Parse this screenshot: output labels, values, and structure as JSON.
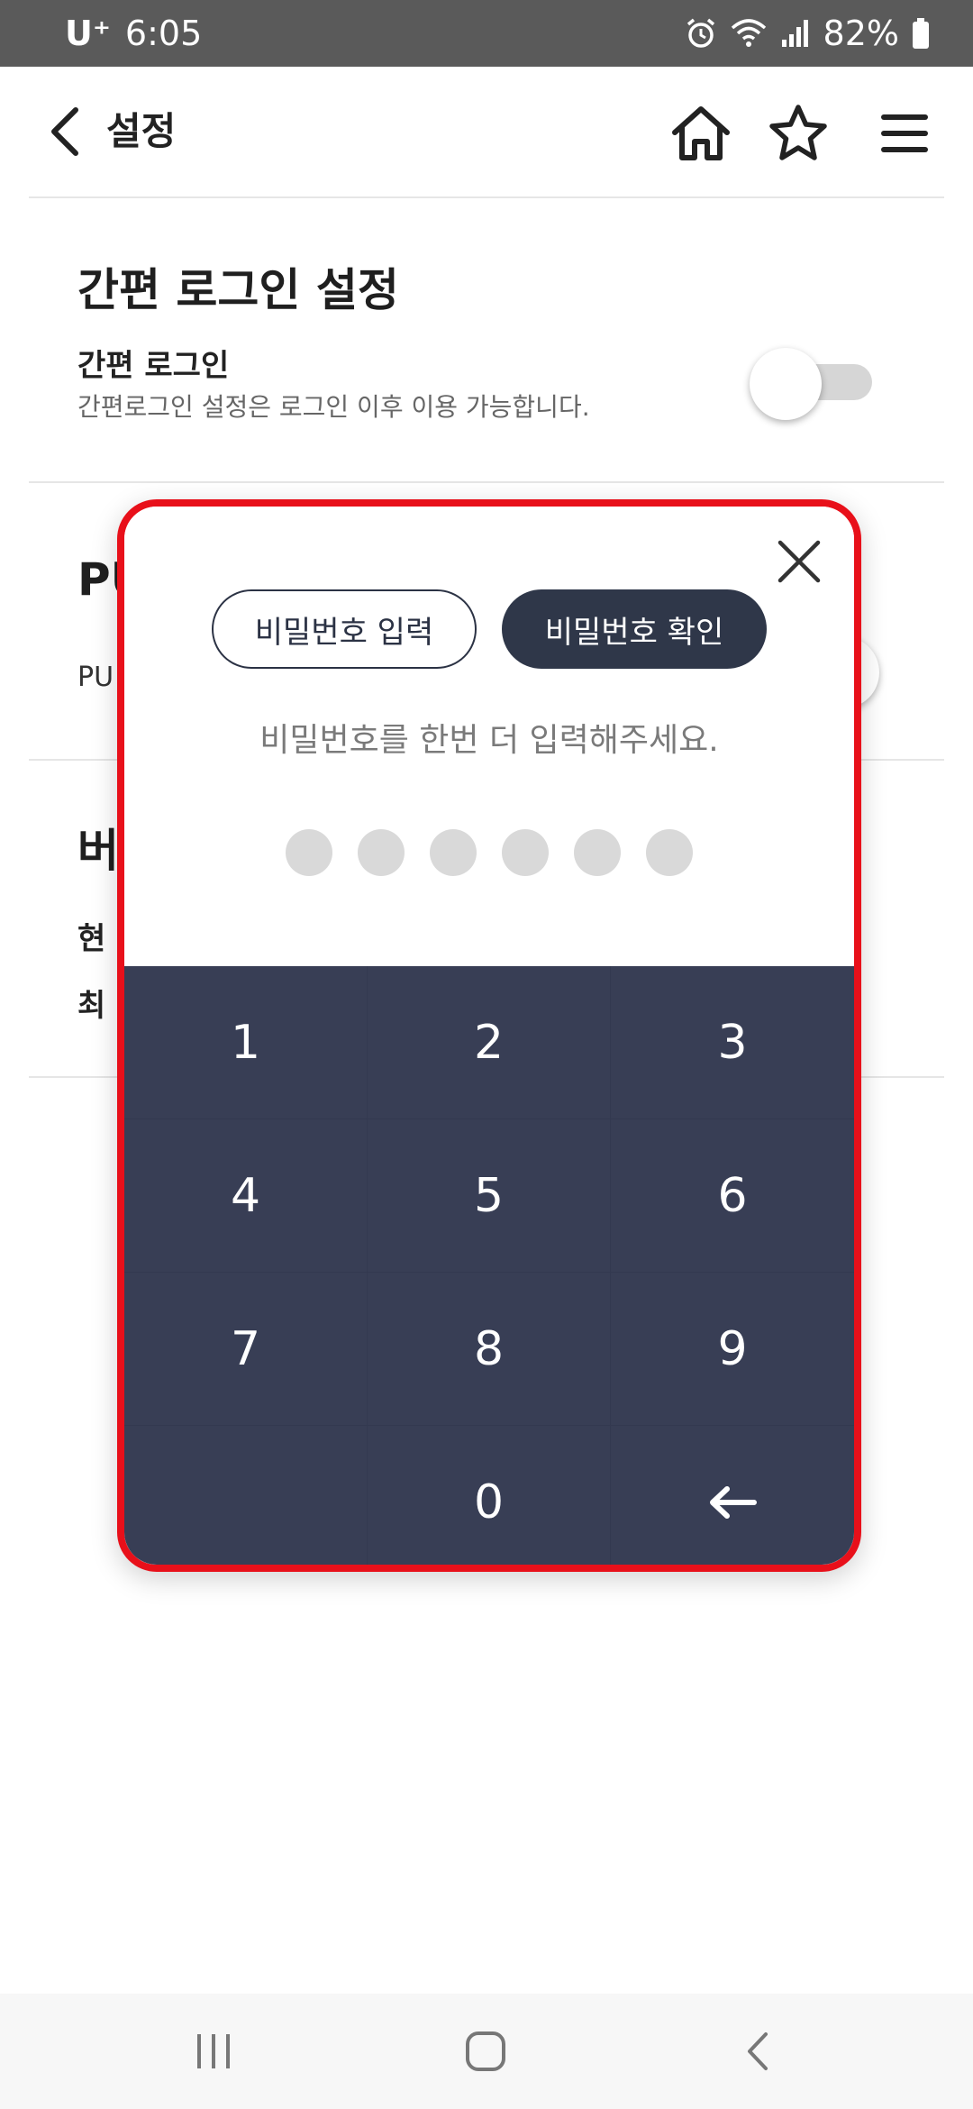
{
  "status_bar": {
    "carrier": "U⁺",
    "time": "6:05",
    "battery": "82%"
  },
  "header": {
    "title": "설정"
  },
  "sections": {
    "easy_login": {
      "title": "간편 로그인 설정",
      "item_title": "간편 로그인",
      "item_desc": "간편로그인 설정은 로그인 이후 이용 가능합니다.",
      "toggle_on": false
    },
    "push": {
      "title_visible": "PU",
      "item_visible": "PU"
    },
    "version": {
      "title_visible": "버",
      "current_visible": "현",
      "latest_visible": "최"
    }
  },
  "modal": {
    "tab_entry": "비밀번호 입력",
    "tab_confirm": "비밀번호 확인",
    "prompt": "비밀번호를 한번 더 입력해주세요.",
    "pin_length": 6,
    "keys": [
      "1",
      "2",
      "3",
      "4",
      "5",
      "6",
      "7",
      "8",
      "9",
      "",
      "0",
      "←"
    ]
  },
  "colors": {
    "keypad_bg": "#383e55",
    "highlight_border": "#e8101a",
    "status_bar_bg": "#5a5a5a"
  },
  "icons": [
    "back-icon",
    "home-icon",
    "star-icon",
    "menu-icon",
    "close-icon",
    "alarm-icon",
    "wifi-icon",
    "signal-icon",
    "battery-icon"
  ]
}
